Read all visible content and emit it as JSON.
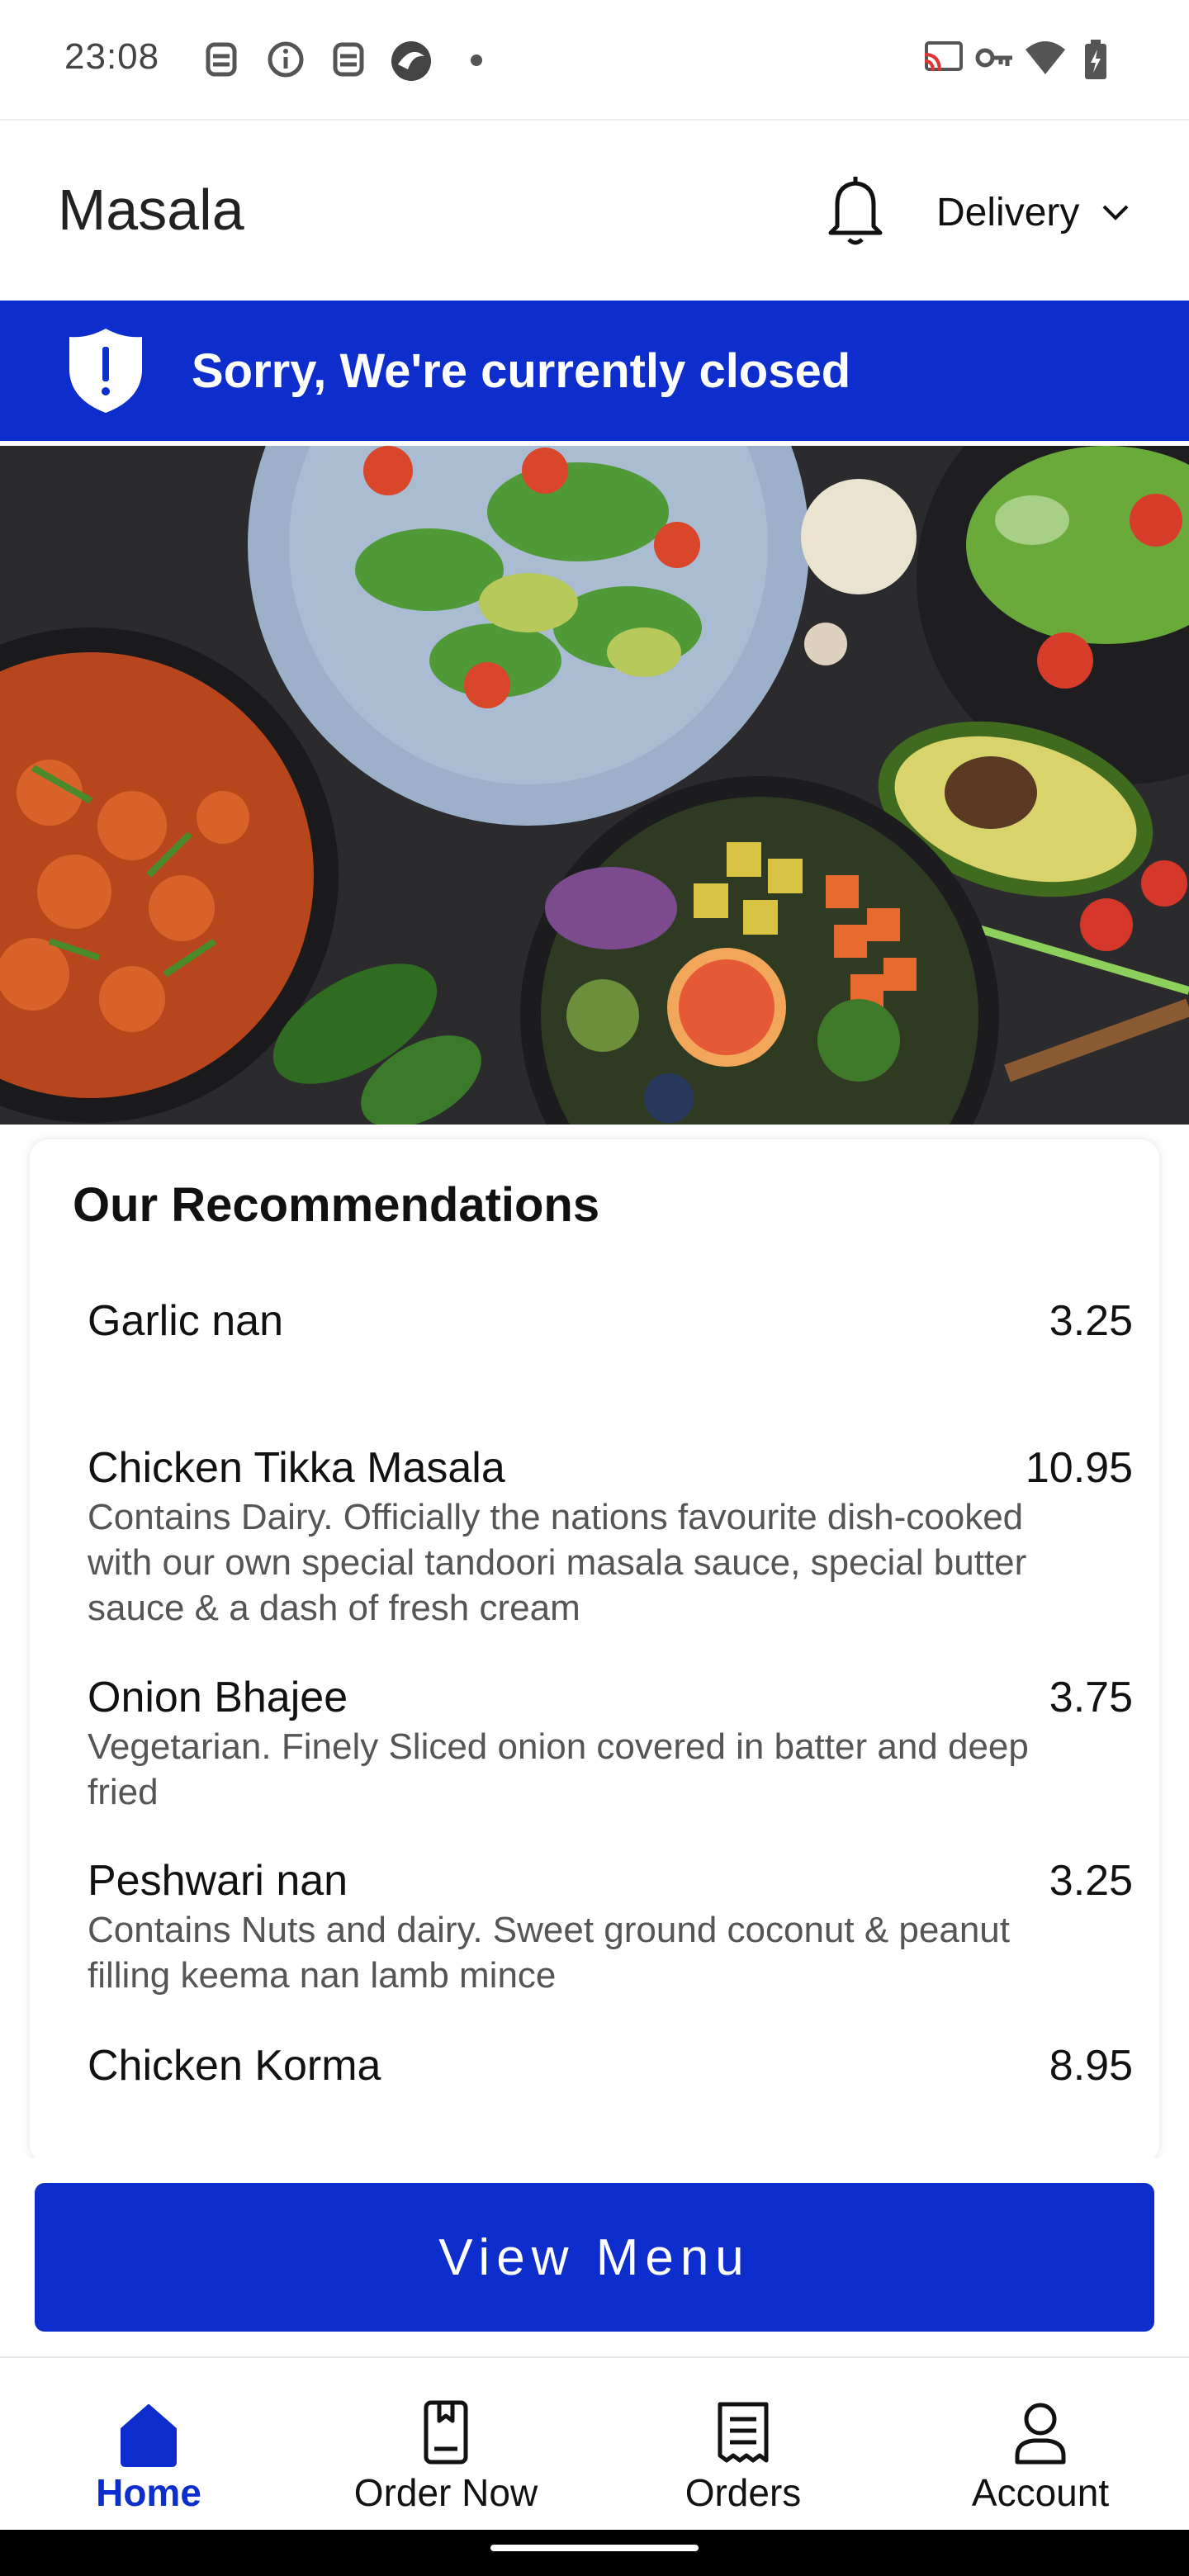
{
  "status_bar": {
    "time": "23:08",
    "icons_left": [
      "assistant-icon",
      "info-icon",
      "assistant-icon",
      "browser-icon",
      "dot-icon"
    ],
    "icons_right": [
      "cast-icon",
      "vpn-key-icon",
      "wifi-icon",
      "battery-charging-icon"
    ]
  },
  "header": {
    "brand": "Masala",
    "notification_icon": "bell-icon",
    "mode_label": "Delivery",
    "mode_icon": "chevron-down-icon"
  },
  "banner": {
    "text": "Sorry, We're currently closed",
    "icon": "shield-alert-icon",
    "color": "#0d2ecc"
  },
  "hero": {
    "icon": "food-photo"
  },
  "recommendations": {
    "title": "Our Recommendations",
    "items": [
      {
        "name": "Garlic nan",
        "price": "3.25",
        "description": ""
      },
      {
        "name": "Chicken Tikka Masala",
        "price": "10.95",
        "description": "Contains Dairy. Officially the nations favourite dish-cooked with our own special tandoori masala sauce, special butter sauce & a dash of fresh cream"
      },
      {
        "name": "Onion Bhajee",
        "price": "3.75",
        "description": "Vegetarian. Finely Sliced onion covered in batter and deep fried"
      },
      {
        "name": "Peshwari nan",
        "price": "3.25",
        "description": "Contains Nuts and dairy. Sweet ground coconut & peanut filling keema nan lamb mince"
      },
      {
        "name": "Chicken Korma",
        "price": "8.95",
        "description": ""
      }
    ]
  },
  "cta": {
    "label": "View Menu"
  },
  "nav": {
    "items": [
      {
        "label": "Home",
        "icon": "home-icon",
        "active": true
      },
      {
        "label": "Order Now",
        "icon": "order-book-icon",
        "active": false
      },
      {
        "label": "Orders",
        "icon": "receipt-icon",
        "active": false
      },
      {
        "label": "Account",
        "icon": "person-icon",
        "active": false
      }
    ],
    "active_color": "#0d2ecc"
  }
}
